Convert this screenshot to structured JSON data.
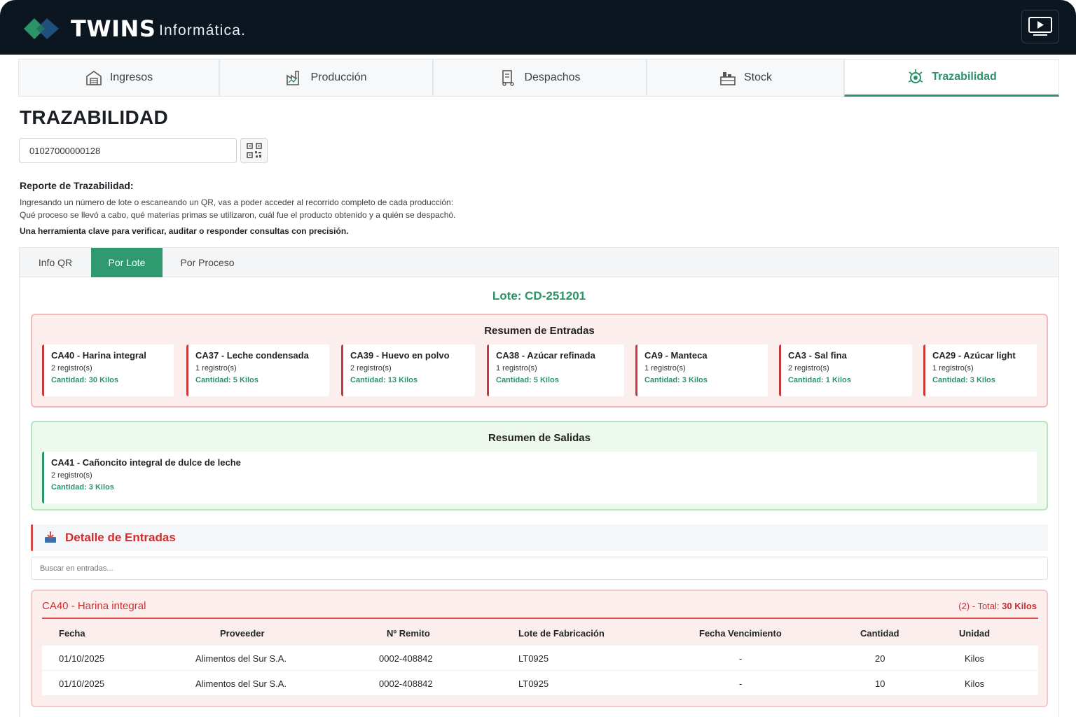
{
  "header": {
    "brand": "TWINS",
    "brand_sub": "Informática.",
    "colors": {
      "bar": "#0c1620",
      "logo_green": "#2a9468",
      "logo_blue": "#1f4f7a"
    }
  },
  "modules": [
    {
      "label": "Ingresos",
      "icon": "warehouse-icon"
    },
    {
      "label": "Producción",
      "icon": "factory-icon"
    },
    {
      "label": "Despachos",
      "icon": "dispatch-icon"
    },
    {
      "label": "Stock",
      "icon": "stock-icon"
    },
    {
      "label": "Trazabilidad",
      "icon": "traceability-icon",
      "active": true
    }
  ],
  "page": {
    "title": "TRAZABILIDAD",
    "lote_value": "01027000000128",
    "report_title": "Reporte de Trazabilidad:",
    "report_line1": "Ingresando un número de lote o escaneando un QR, vas a poder acceder al recorrido completo de cada producción:",
    "report_line2": "Qué proceso se llevó a cabo, qué materias primas se utilizaron, cuál fue el producto obtenido y a quién se despachó.",
    "report_bold": "Una herramienta clave para verificar, auditar o responder consultas con precisión."
  },
  "subtabs": [
    {
      "label": "Info QR"
    },
    {
      "label": "Por Lote",
      "active": true
    },
    {
      "label": "Por Proceso"
    }
  ],
  "lote_label": "Lote: CD-251201",
  "entradas": {
    "title": "Resumen de Entradas",
    "items": [
      {
        "name": "CA40 - Harina integral",
        "registros": "2 registro(s)",
        "cantidad": "Cantidad: 30 Kilos"
      },
      {
        "name": "CA37 - Leche condensada",
        "registros": "1 registro(s)",
        "cantidad": "Cantidad: 5 Kilos"
      },
      {
        "name": "CA39 - Huevo en polvo",
        "registros": "2 registro(s)",
        "cantidad": "Cantidad: 13 Kilos"
      },
      {
        "name": "CA38 - Azúcar refinada",
        "registros": "1 registro(s)",
        "cantidad": "Cantidad: 5 Kilos"
      },
      {
        "name": "CA9 - Manteca",
        "registros": "1 registro(s)",
        "cantidad": "Cantidad: 3 Kilos"
      },
      {
        "name": "CA3 - Sal fina",
        "registros": "2 registro(s)",
        "cantidad": "Cantidad: 1 Kilos"
      },
      {
        "name": "CA29 - Azúcar light",
        "registros": "1 registro(s)",
        "cantidad": "Cantidad: 3 Kilos"
      }
    ]
  },
  "salidas": {
    "title": "Resumen de Salidas",
    "items": [
      {
        "name": "CA41 - Cañoncito integral de dulce de leche",
        "registros": "2 registro(s)",
        "cantidad": "Cantidad: 3 Kilos"
      }
    ]
  },
  "detalle": {
    "title": "Detalle de Entradas",
    "search_placeholder": "Buscar en entradas...",
    "group": {
      "name": "CA40 - Harina integral",
      "count": "(2) - Total: ",
      "total": "30 Kilos",
      "columns": [
        "Fecha",
        "Proveeder",
        "Nº Remito",
        "Lote de Fabricación",
        "Fecha Vencimiento",
        "Cantidad",
        "Unidad"
      ],
      "rows": [
        [
          "01/10/2025",
          "Alimentos del Sur S.A.",
          "0002-408842",
          "LT0925",
          "-",
          "20",
          "Kilos"
        ],
        [
          "01/10/2025",
          "Alimentos del Sur S.A.",
          "0002-408842",
          "LT0925",
          "-",
          "10",
          "Kilos"
        ]
      ]
    }
  }
}
